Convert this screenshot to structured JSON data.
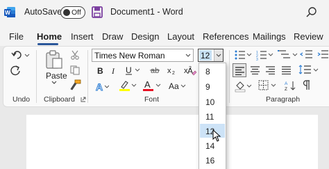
{
  "titlebar": {
    "autosave_label": "AutoSave",
    "autosave_state": "Off",
    "document_title": "Document1  -  Word"
  },
  "menu": {
    "tabs": [
      "File",
      "Home",
      "Insert",
      "Draw",
      "Design",
      "Layout",
      "References",
      "Mailings",
      "Review"
    ],
    "active_tab": "Home"
  },
  "ribbon": {
    "undo_group_label": "Undo",
    "clipboard": {
      "paste_label": "Paste",
      "group_label": "Clipboard"
    },
    "font": {
      "font_name": "Times New Roman",
      "font_size": "12",
      "group_label": "Font",
      "change_case_label": "Aa"
    },
    "paragraph": {
      "group_label": "Paragraph"
    }
  },
  "font_size_dropdown": {
    "options": [
      "8",
      "9",
      "10",
      "11",
      "12",
      "14",
      "16"
    ],
    "selected": "12"
  },
  "colors": {
    "accent": "#2b579a",
    "word_blue": "#185abd",
    "highlight_yellow": "#ffff00",
    "font_color_red": "#e81123",
    "save_purple": "#7b3fa0"
  }
}
